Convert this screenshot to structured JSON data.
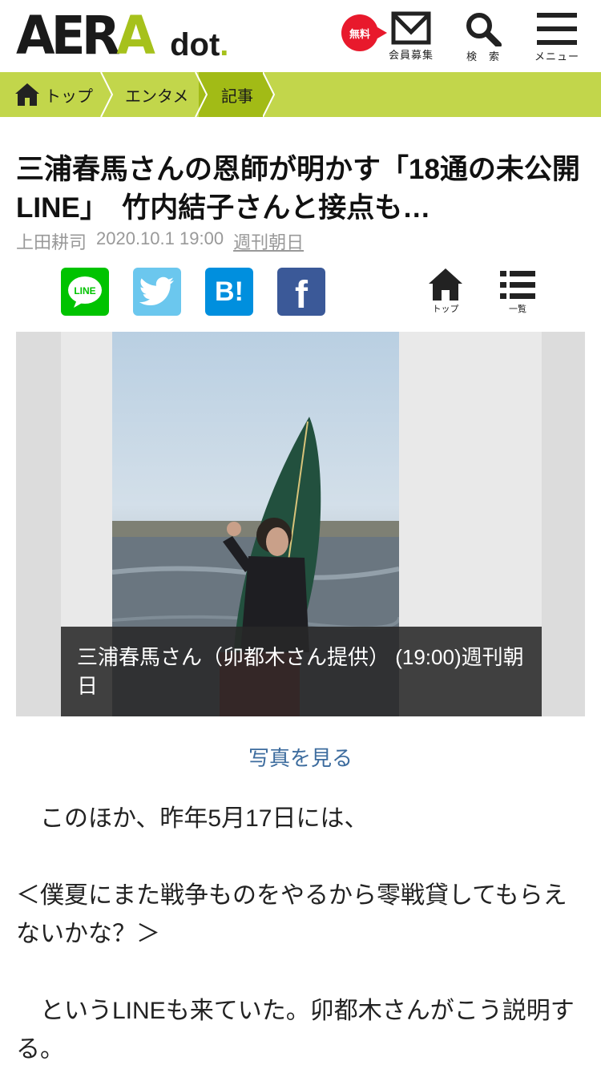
{
  "header": {
    "logo_main": "AERA",
    "logo_sub": "dot",
    "free_badge": "無料",
    "member_label": "会員募集",
    "search_label": "検　索",
    "menu_label": "メニュー"
  },
  "breadcrumb": {
    "items": [
      {
        "label": "トップ"
      },
      {
        "label": "エンタメ"
      },
      {
        "label": "記事"
      }
    ]
  },
  "article": {
    "title": "三浦春馬さんの恩師が明かす「18通の未公開LINE」　竹内結子さんと接点も…",
    "author": "上田耕司",
    "date": "2020.10.1 19:00",
    "source": "週刊朝日"
  },
  "share": {
    "line_label": "LINE",
    "hatena_label": "B!",
    "facebook_label": "f",
    "nav_top_label": "トップ",
    "nav_list_label": "一覧"
  },
  "photo": {
    "caption": "三浦春馬さん（卯都木さん提供） (19:00)週刊朝日",
    "link_label": "写真を見る"
  },
  "body": {
    "paragraphs": [
      "　このほか、昨年5月17日には、",
      "＜僕夏にまた戦争ものをやるから零戦貸してもらえないかな？＞",
      "　というLINEも来ていた。卯都木さんがこう説明する。"
    ]
  },
  "colors": {
    "brand_green": "#a6c11c",
    "breadcrumb_bg": "#c2d64b",
    "badge_red": "#e8192c",
    "link_blue": "#3d6c9e"
  }
}
